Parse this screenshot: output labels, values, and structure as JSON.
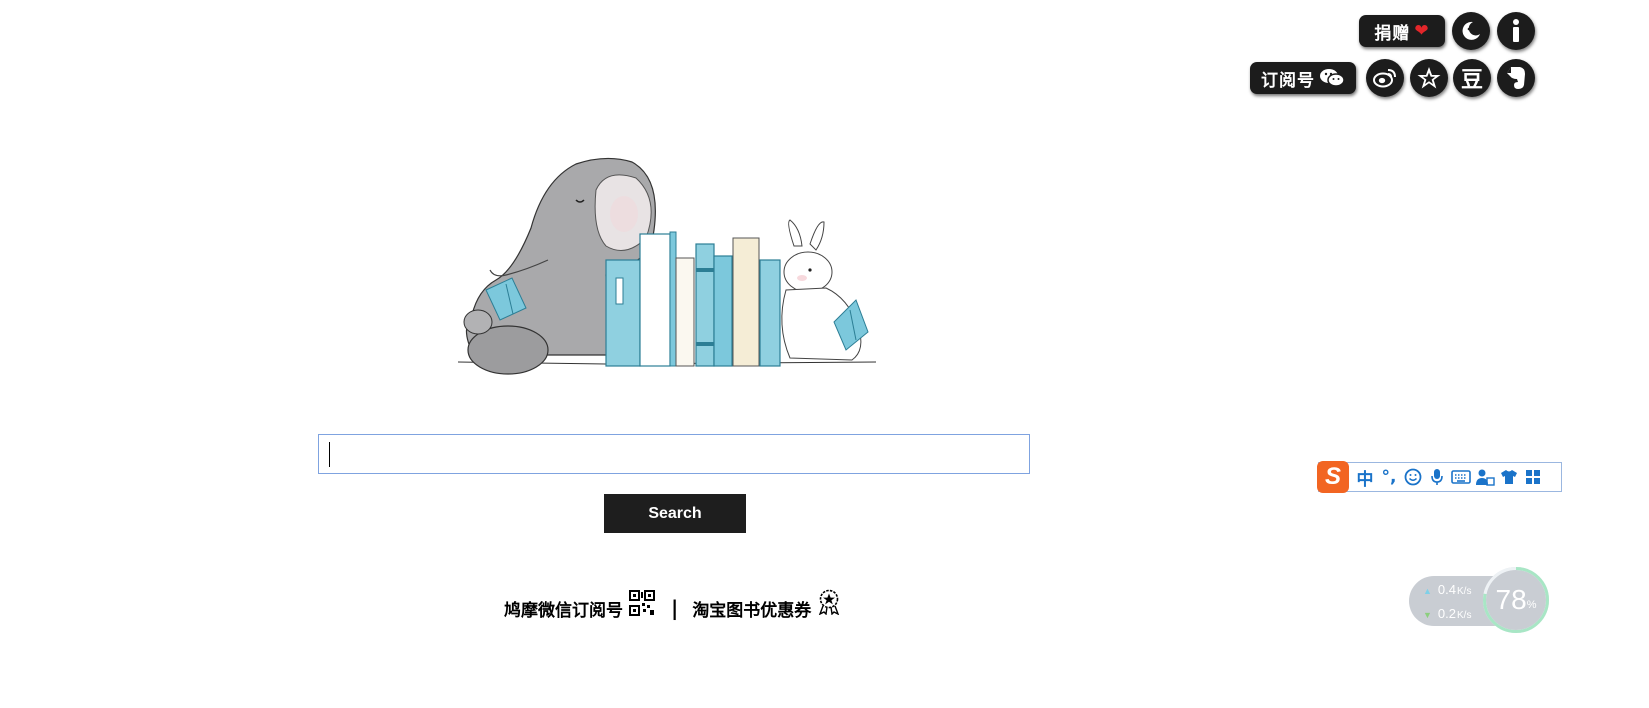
{
  "top_bar": {
    "donate_label": "捐赠",
    "subscribe_label": "订阅号",
    "icons": [
      "moon-icon",
      "info-icon",
      "weibo-icon",
      "star-icon",
      "douban-icon",
      "evernote-icon"
    ],
    "douban_glyph": "豆"
  },
  "search": {
    "value": "",
    "button_label": "Search"
  },
  "links": {
    "wechat_label": "鸠摩微信订阅号",
    "separator": "|",
    "taobao_label": "淘宝图书优惠券"
  },
  "ime_toolbar": {
    "logo": "S",
    "mode": "中",
    "punct": "°,",
    "icons": [
      "emoji-icon",
      "mic-icon",
      "keyboard-icon",
      "user-icon",
      "skin-icon",
      "grid-icon"
    ]
  },
  "net_widget": {
    "up_value": "0.4",
    "up_unit": "K/s",
    "down_value": "0.2",
    "down_unit": "K/s",
    "percent": "78",
    "percent_unit": "%",
    "percent_fraction": 0.78
  },
  "colors": {
    "badge_bg": "#1c1c1c",
    "heart": "#e3262a",
    "search_border": "#7fa3e0",
    "button_bg": "#1e1e1e",
    "ime_accent": "#1a73c9",
    "ime_logo": "#f26522",
    "book_blue": "#7cc8dc"
  }
}
